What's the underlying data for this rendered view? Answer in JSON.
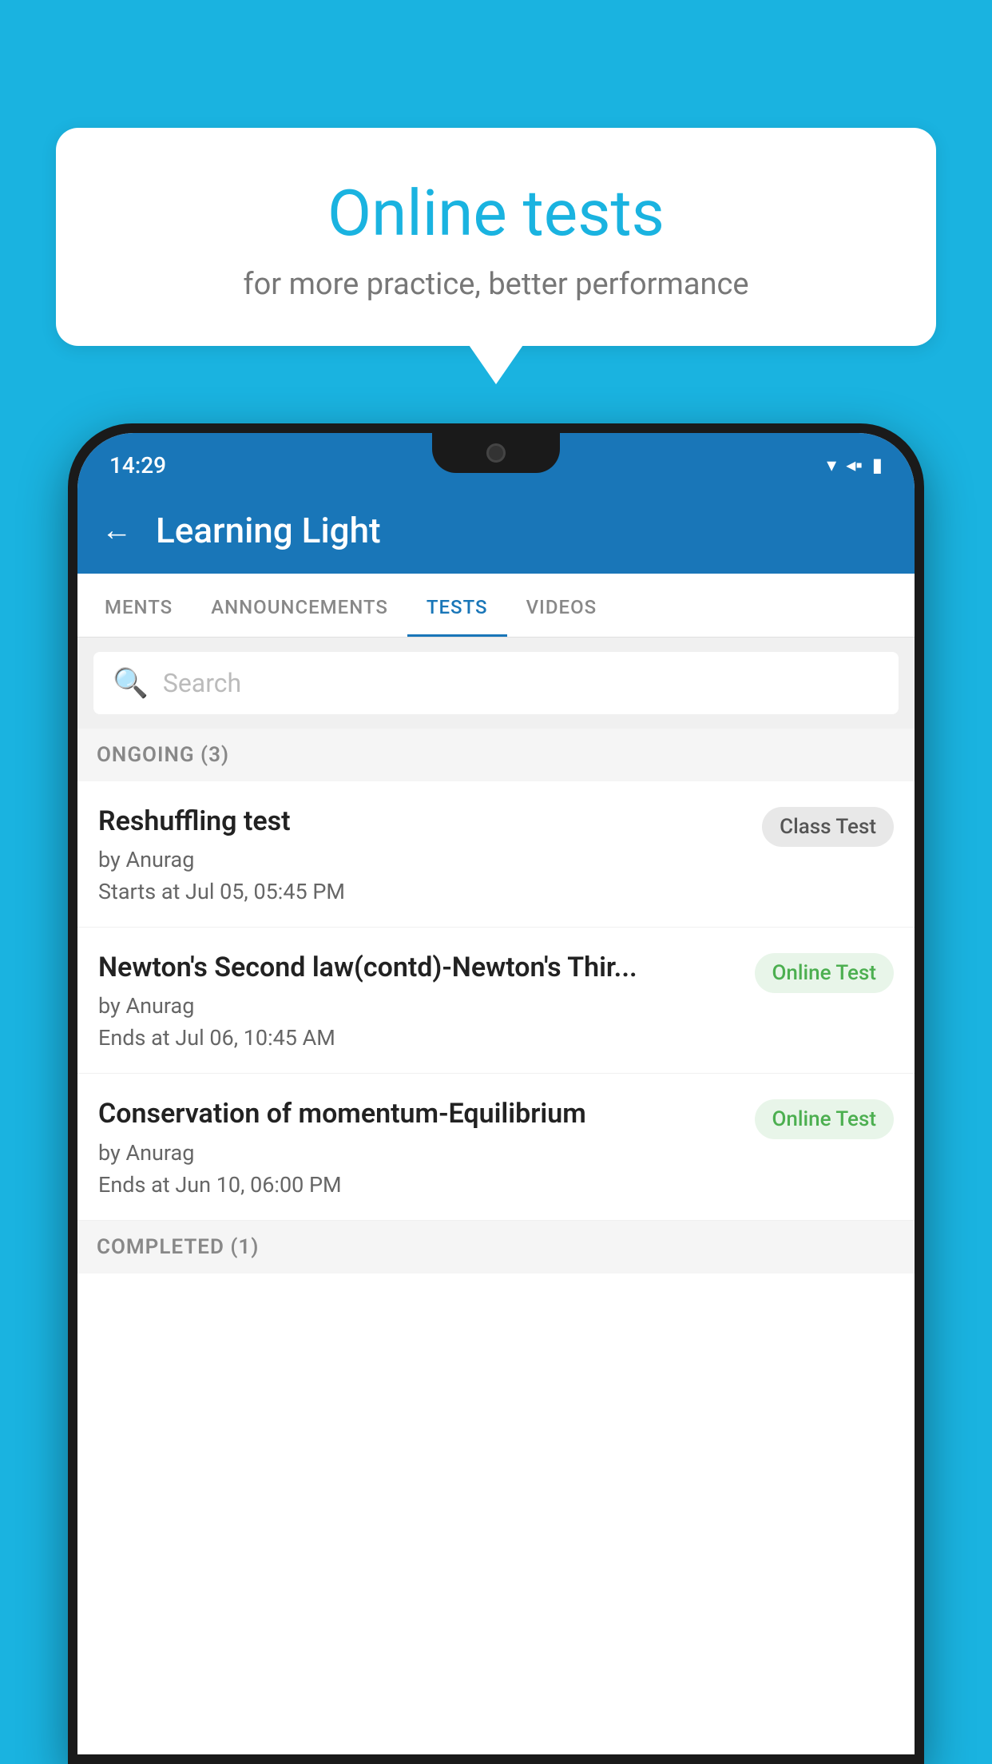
{
  "background_color": "#1ab3e0",
  "bubble": {
    "title": "Online tests",
    "subtitle": "for more practice, better performance"
  },
  "status_bar": {
    "time": "14:29",
    "wifi_icon": "▾",
    "signal_icon": "◂",
    "battery_icon": "▮"
  },
  "header": {
    "back_label": "←",
    "title": "Learning Light"
  },
  "tabs": [
    {
      "label": "MENTS",
      "active": false
    },
    {
      "label": "ANNOUNCEMENTS",
      "active": false
    },
    {
      "label": "TESTS",
      "active": true
    },
    {
      "label": "VIDEOS",
      "active": false
    }
  ],
  "search": {
    "placeholder": "Search",
    "icon": "🔍"
  },
  "ongoing_section": {
    "label": "ONGOING (3)"
  },
  "test_items": [
    {
      "name": "Reshuffling test",
      "author": "by Anurag",
      "date": "Starts at  Jul 05, 05:45 PM",
      "badge": "Class Test",
      "badge_type": "class"
    },
    {
      "name": "Newton's Second law(contd)-Newton's Thir...",
      "author": "by Anurag",
      "date": "Ends at  Jul 06, 10:45 AM",
      "badge": "Online Test",
      "badge_type": "online"
    },
    {
      "name": "Conservation of momentum-Equilibrium",
      "author": "by Anurag",
      "date": "Ends at  Jun 10, 06:00 PM",
      "badge": "Online Test",
      "badge_type": "online"
    }
  ],
  "completed_section": {
    "label": "COMPLETED (1)"
  }
}
